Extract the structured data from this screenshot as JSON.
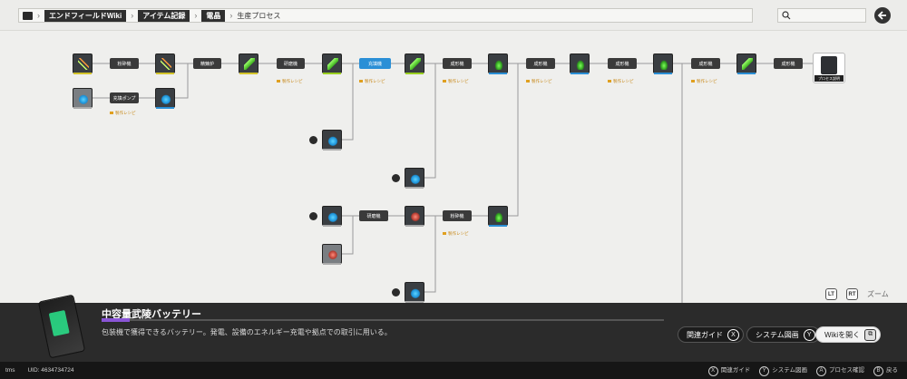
{
  "breadcrumb": {
    "items": [
      "エンドフィールドWiki",
      "アイテム記録",
      "電晶"
    ],
    "current": "生産プロセス"
  },
  "graph": {
    "processes": [
      "粉砕機",
      "充填ポンプ",
      "精錬炉",
      "研磨機",
      "充填機",
      "成形機",
      "成形機",
      "成形機",
      "成形機",
      "成形機",
      "研磨機",
      "粉砕機",
      "充填機"
    ],
    "tags": [
      "製作レシピ"
    ],
    "final_label": "プロセス説明"
  },
  "zoom": {
    "lt": "LT",
    "rt": "RT",
    "label": "ズーム"
  },
  "panel": {
    "title": "中容量武陵バッテリー",
    "progress": 0.05,
    "description": "包装機で獲得できるバッテリー。発電、設備のエネルギー充電や拠点での取引に用いる。",
    "btn_guide": "関連ガイド",
    "btn_guide_key": "X",
    "btn_system": "システム図画",
    "btn_system_key": "Y",
    "btn_wiki": "Wikiを開く"
  },
  "footer": {
    "user": "tms",
    "uid": "UID: 4634734724",
    "actions": [
      {
        "key": "X",
        "label": "関連ガイド"
      },
      {
        "key": "Y",
        "label": "システム図画"
      },
      {
        "key": "A",
        "label": "プロセス確認"
      },
      {
        "key": "B",
        "label": "戻る"
      }
    ]
  },
  "colors": {
    "accent": "#8a55d6",
    "blue": "#2a8fd6",
    "tag": "#c88a1c"
  }
}
